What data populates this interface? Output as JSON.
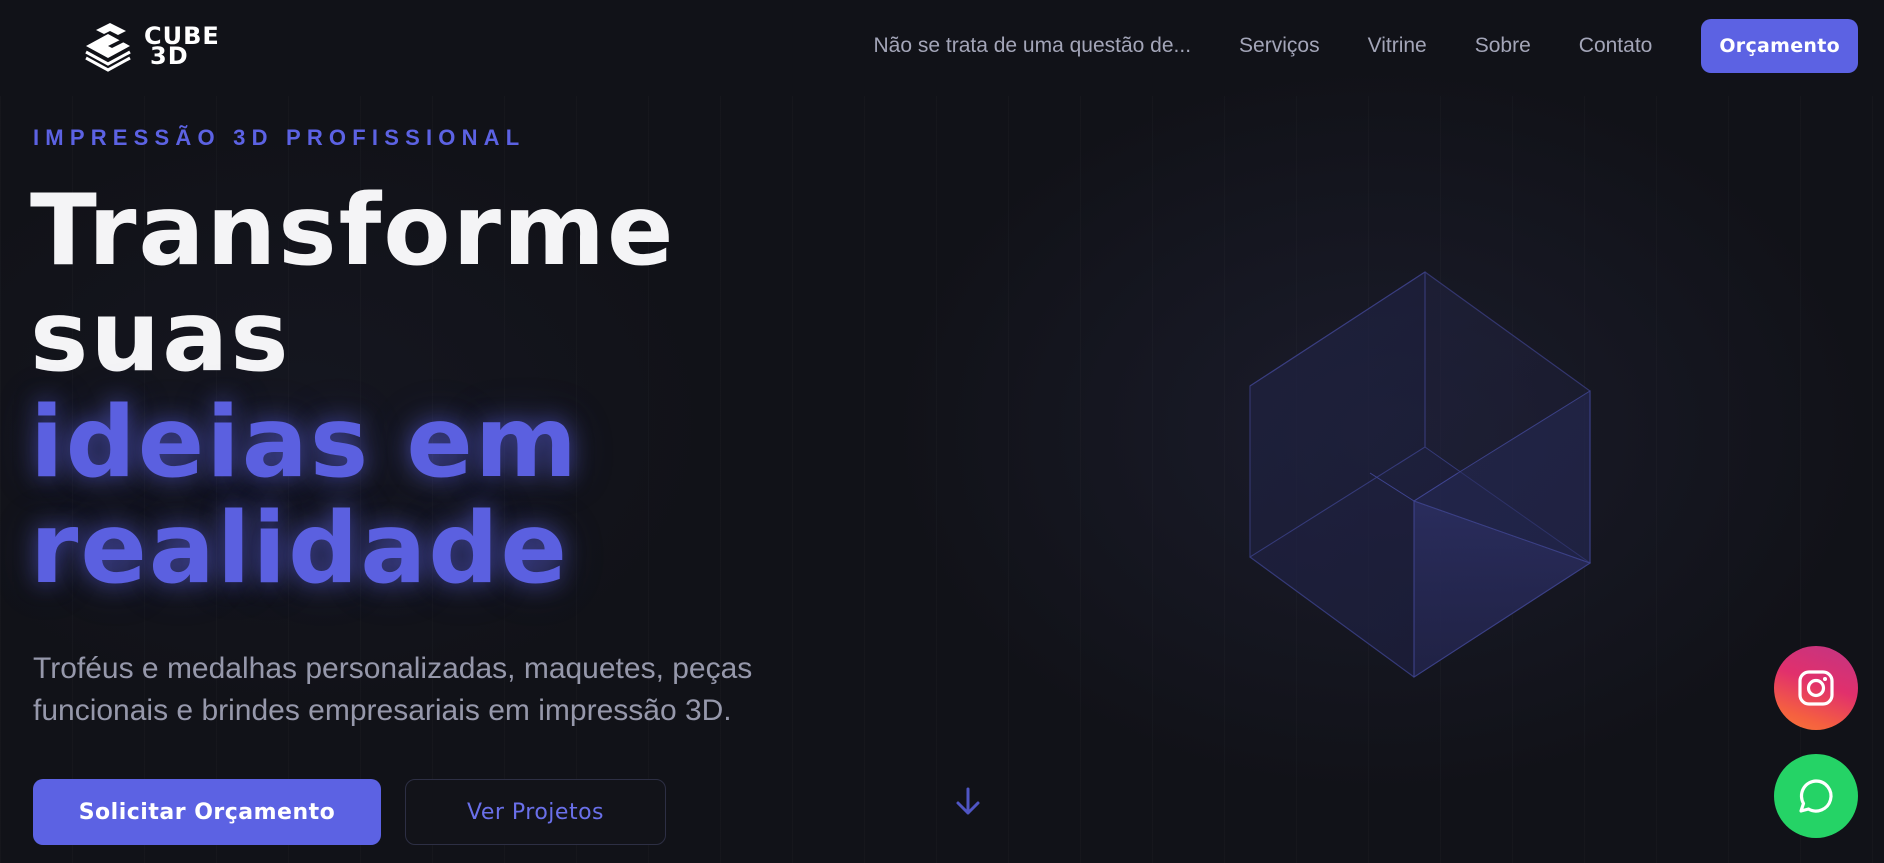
{
  "brand": {
    "logo_line1": "CUBE",
    "logo_line2": "3D",
    "logo_icon": "cube-stack-logo"
  },
  "nav": {
    "items": [
      {
        "label": "Não se trata de uma questão de..."
      },
      {
        "label": "Serviços"
      },
      {
        "label": "Vitrine"
      },
      {
        "label": "Sobre"
      },
      {
        "label": "Contato"
      }
    ],
    "cta_label": "Orçamento"
  },
  "hero": {
    "eyebrow": "IMPRESSÃO 3D PROFISSIONAL",
    "headline_line1": "Transforme",
    "headline_line2": "suas",
    "headline_accent_line1": "ideias em",
    "headline_accent_line2": "realidade",
    "subtitle_line1": "Troféus e medalhas personalizadas, maquetes, peças",
    "subtitle_line2": "funcionais e brindes empresariais em impressão 3D.",
    "primary_button": "Solicitar Orçamento",
    "secondary_button": "Ver Projetos",
    "scroll_icon": "arrow-down-icon",
    "illustration": "wireframe-cube-icon"
  },
  "floating": {
    "instagram_icon": "instagram-icon",
    "whatsapp_icon": "whatsapp-icon"
  },
  "colors": {
    "background": "#111218",
    "accent": "#5c62e3",
    "text_primary": "#f4f4f6",
    "text_muted": "#9698ab",
    "whatsapp": "#25d366",
    "instagram": "#e1306c"
  }
}
